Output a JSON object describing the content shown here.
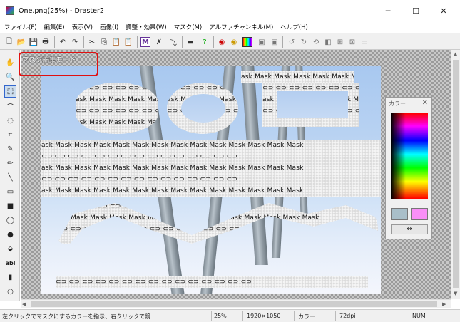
{
  "window": {
    "title": "One.png(25%) - Draster2",
    "minimize_glyph": "─",
    "maximize_glyph": "☐",
    "close_glyph": "✕"
  },
  "menu": [
    "ファイル(F)",
    "編集(E)",
    "表示(V)",
    "画像(I)",
    "調整・効果(W)",
    "マスク(M)",
    "アルファチャンネル(M)",
    "ヘルプ(H)"
  ],
  "overlay": {
    "mode_label": "マスク編集モード"
  },
  "mask": {
    "word": "Mask",
    "row_text": "ask Mask Mask Mask Mask Mask Mask Mask Mask Mask Mask Mask Mask Mask",
    "icon_row": "⊂⊃ ⊂⊃ ⊂⊃ ⊂⊃ ⊂⊃ ⊂⊃ ⊂⊃ ⊂⊃ ⊂⊃ ⊂⊃ ⊂⊃ ⊂⊃ ⊂⊃ ⊂⊃ ⊂⊃"
  },
  "color_panel": {
    "title": "カラー",
    "close": "✕",
    "swap_glyph": "⇔",
    "primary_color": "#a9bfc9",
    "secondary_color": "#f98ff7"
  },
  "status": {
    "hint": "左クリックでマスクにするカラーを指示、右クリックで鏡",
    "zoom": "25%",
    "size": "1920×1050",
    "color_label": "カラー",
    "dpi": "72dpi",
    "num": "NUM"
  },
  "toolbar_icons": [
    "new-icon",
    "open-icon",
    "save-icon",
    "print-icon",
    "undo-icon",
    "redo-icon",
    "cut-icon",
    "copy-icon",
    "paste-icon",
    "paste-special-icon",
    "mask-m-icon",
    "mask-tool-icon",
    "brush-line-icon",
    "line-width-icon",
    "help-icon",
    "record-icon",
    "record2-icon",
    "palette-icon",
    "image-icon",
    "image2-icon",
    "rotate-left-icon",
    "rotate-right-icon",
    "rotate-icon",
    "flip-icon",
    "resize-icon",
    "crop-icon",
    "frame-icon"
  ],
  "tools": [
    "hand-icon",
    "zoom-icon",
    "rect-select-icon",
    "lasso-icon",
    "magic-lasso-icon",
    "crop-icon",
    "eyedropper-icon",
    "pencil-icon",
    "line-icon",
    "rectangle-icon",
    "filled-rectangle-icon",
    "ellipse-icon",
    "filled-ellipse-icon",
    "fill-icon",
    "text-icon",
    "gradient-icon",
    "eraser-icon"
  ],
  "tool_glyphs": [
    "✋",
    "🔍",
    "⬚",
    "⌒",
    "◌",
    "⌗",
    "✎",
    "✏",
    "╲",
    "▭",
    "■",
    "◯",
    "●",
    "⬙",
    "abl",
    "▮",
    "○"
  ]
}
